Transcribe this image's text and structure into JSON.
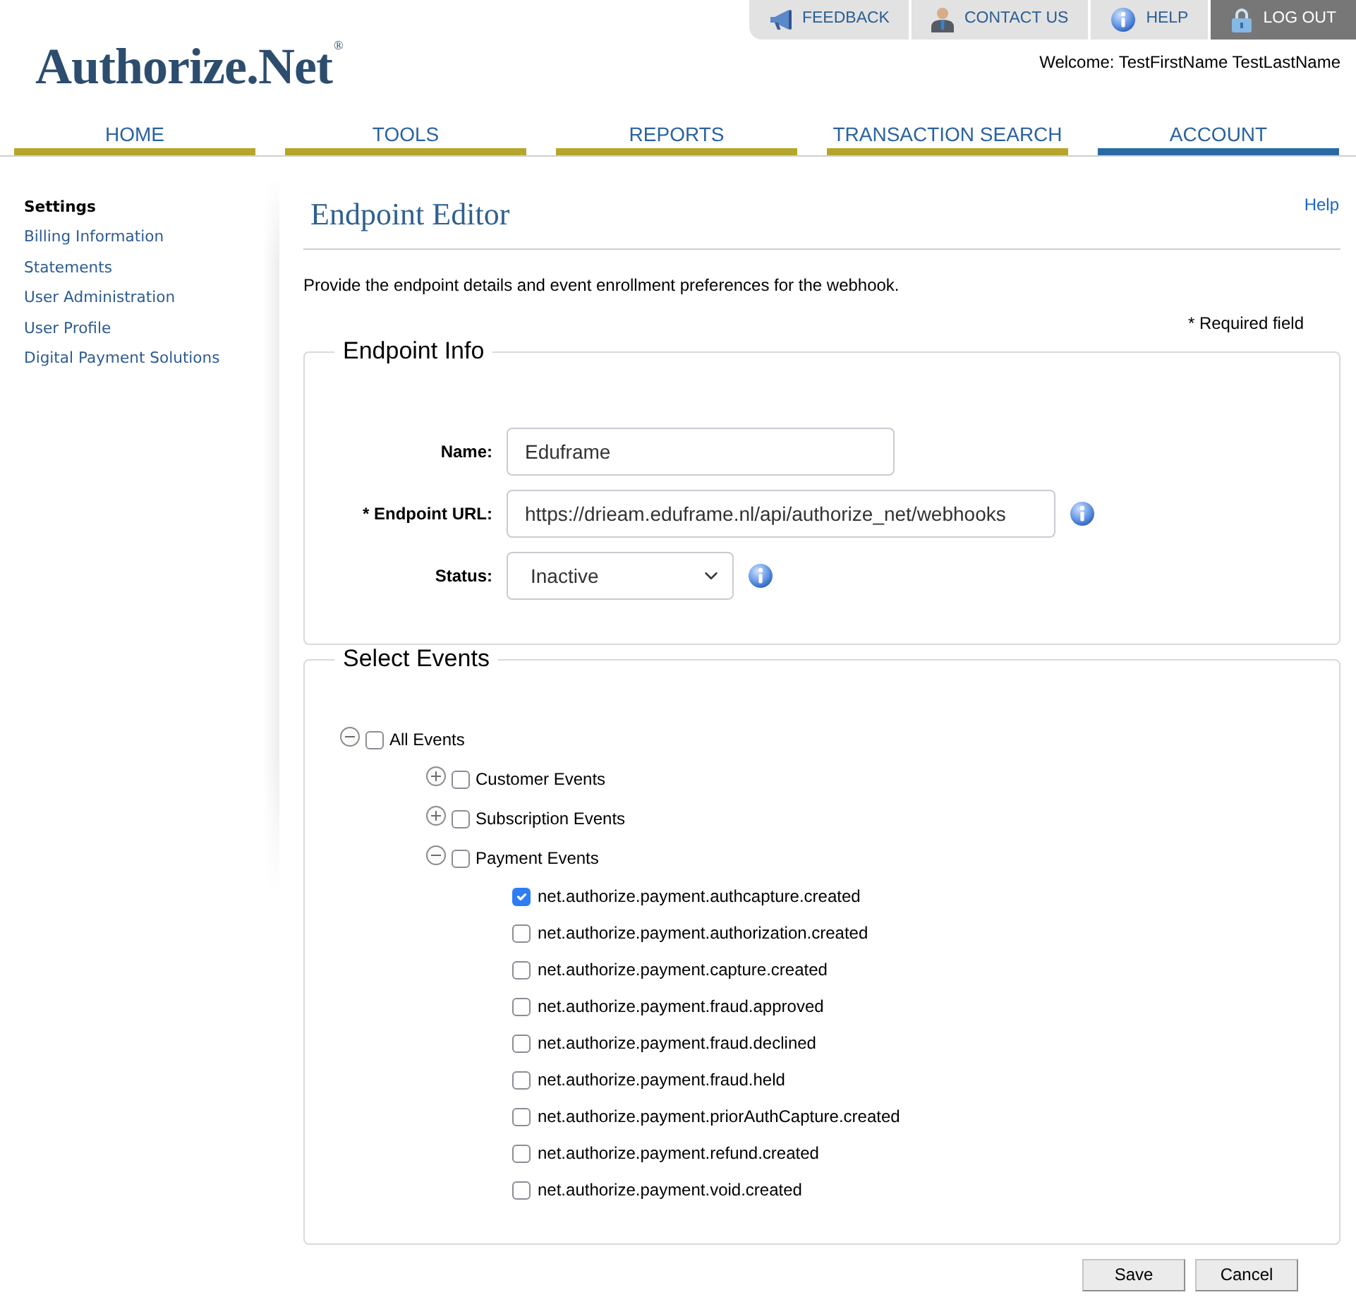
{
  "utility_links": [
    {
      "kind": "feedback",
      "label": "FEEDBACK"
    },
    {
      "kind": "contact",
      "label": "CONTACT US"
    },
    {
      "kind": "help",
      "label": "HELP"
    },
    {
      "kind": "logout",
      "label": "LOG OUT"
    }
  ],
  "logo": {
    "text": "Authorize.Net$^{®}$"
  },
  "welcome": "Welcome: TestFirstName TestLastName",
  "nav_tabs": [
    {
      "label": "HOME",
      "selected": false
    },
    {
      "label": "TOOLS",
      "selected": false
    },
    {
      "label": "REPORTS",
      "selected": false
    },
    {
      "label": "TRANSACTION SEARCH",
      "selected": false
    },
    {
      "label": "ACCOUNT",
      "selected": true
    }
  ],
  "sidebar": {
    "items": [
      {
        "label": "Settings",
        "selected": true
      },
      {
        "label": "Billing Information",
        "selected": false
      },
      {
        "label": "Statements",
        "selected": false
      },
      {
        "label": "User Administration",
        "selected": false
      },
      {
        "label": "User Profile",
        "selected": false
      },
      {
        "label": "Digital Payment Solutions",
        "selected": false
      }
    ]
  },
  "page": {
    "title": "Endpoint Editor",
    "help_link": "Help",
    "description": "Provide the endpoint details and event enrollment preferences for the webhook.",
    "required_note": "* Required field"
  },
  "endpoint_info": {
    "legend": "Endpoint Info",
    "fields": [
      {
        "kind": "text",
        "label": "Name:",
        "value": "Eduframe"
      },
      {
        "kind": "text",
        "label": "* Endpoint URL:",
        "value": "https://drieam.eduframe.nl/api/authorize_net/webhooks",
        "info": true
      },
      {
        "kind": "select",
        "label": "Status:",
        "value": "Inactive",
        "info": true
      }
    ]
  },
  "select_events": {
    "legend": "Select Events",
    "tree": [
      {
        "label": "All Events",
        "expanded": true,
        "checked": false,
        "children": [
          {
            "label": "Customer Events",
            "expanded": false,
            "checked": false
          },
          {
            "label": "Subscription Events",
            "expanded": false,
            "checked": false
          },
          {
            "label": "Payment Events",
            "expanded": true,
            "checked": false,
            "children": [
              {
                "label": "net.authorize.payment.authcapture.created",
                "checked": true
              },
              {
                "label": "net.authorize.payment.authorization.created",
                "checked": false
              },
              {
                "label": "net.authorize.payment.capture.created",
                "checked": false
              },
              {
                "label": "net.authorize.payment.fraud.approved",
                "checked": false
              },
              {
                "label": "net.authorize.payment.fraud.declined",
                "checked": false
              },
              {
                "label": "net.authorize.payment.fraud.held",
                "checked": false
              },
              {
                "label": "net.authorize.payment.priorAuthCapture.created",
                "checked": false
              },
              {
                "label": "net.authorize.payment.refund.created",
                "checked": false
              },
              {
                "label": "net.authorize.payment.void.created",
                "checked": false
              }
            ]
          }
        ]
      }
    ]
  },
  "buttons": [
    "Save",
    "Cancel"
  ]
}
